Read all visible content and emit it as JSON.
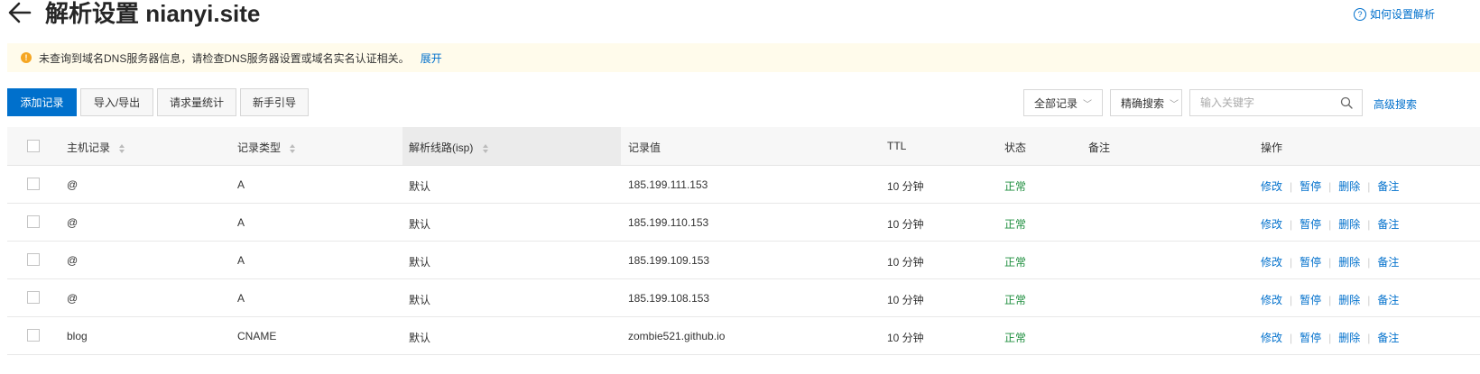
{
  "header": {
    "title": "解析设置 nianyi.site",
    "help_link": "如何设置解析"
  },
  "notice": {
    "text": "未查询到域名DNS服务器信息，请检查DNS服务器设置或域名实名认证相关。",
    "expand_link": "展开"
  },
  "toolbar": {
    "add_record": "添加记录",
    "import_export": "导入/导出",
    "request_stats": "请求量统计",
    "guide": "新手引导",
    "filter_select": "全部记录",
    "search_mode_select": "精确搜索",
    "search_placeholder": "输入关键字",
    "advanced_search": "高级搜索"
  },
  "table": {
    "columns": {
      "host": "主机记录",
      "type": "记录类型",
      "line": "解析线路(isp)",
      "value": "记录值",
      "ttl": "TTL",
      "status": "状态",
      "remark": "备注",
      "ops": "操作"
    },
    "actions": [
      "修改",
      "暂停",
      "删除",
      "备注"
    ],
    "rows": [
      {
        "host": "@",
        "type": "A",
        "line": "默认",
        "value": "185.199.111.153",
        "ttl": "10 分钟",
        "status": "正常",
        "remark": ""
      },
      {
        "host": "@",
        "type": "A",
        "line": "默认",
        "value": "185.199.110.153",
        "ttl": "10 分钟",
        "status": "正常",
        "remark": ""
      },
      {
        "host": "@",
        "type": "A",
        "line": "默认",
        "value": "185.199.109.153",
        "ttl": "10 分钟",
        "status": "正常",
        "remark": ""
      },
      {
        "host": "@",
        "type": "A",
        "line": "默认",
        "value": "185.199.108.153",
        "ttl": "10 分钟",
        "status": "正常",
        "remark": ""
      },
      {
        "host": "blog",
        "type": "CNAME",
        "line": "默认",
        "value": "zombie521.github.io",
        "ttl": "10 分钟",
        "status": "正常",
        "remark": ""
      }
    ]
  },
  "colors": {
    "accent": "#0070cc",
    "status_ok": "#1e8e3e",
    "notice_bg": "#fffbeb",
    "warning": "#f5a623"
  },
  "icons": {
    "back": "back-arrow-icon",
    "help": "help-icon",
    "warning": "warning-icon",
    "search": "search-icon",
    "sort": "sort-icon",
    "dropdown": "chevron-down-icon"
  }
}
